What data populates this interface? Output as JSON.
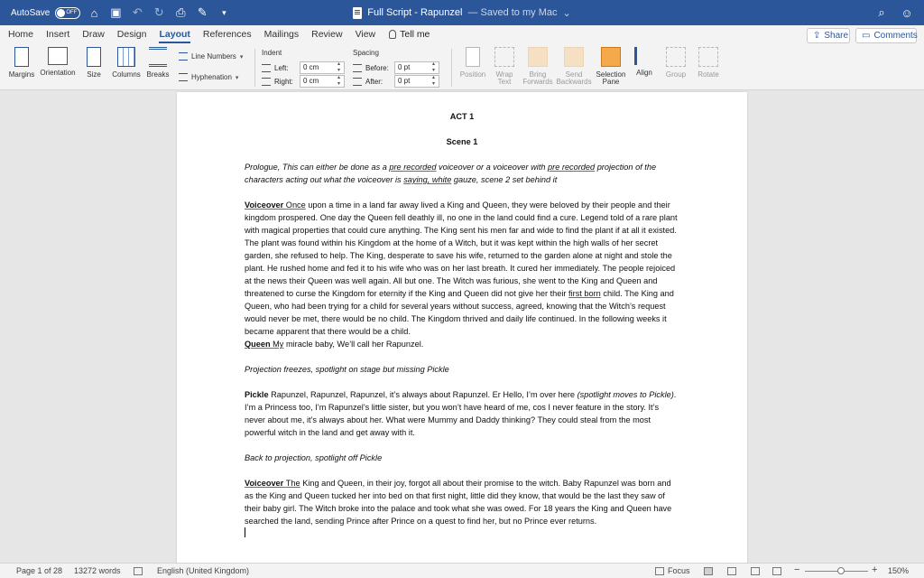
{
  "titlebar": {
    "autosave_label": "AutoSave",
    "autosave_state": "OFF",
    "doc_title": "Full Script - Rapunzel",
    "save_status": "— Saved to my Mac",
    "title_caret": "⌄"
  },
  "tabs": [
    "Home",
    "Insert",
    "Draw",
    "Design",
    "Layout",
    "References",
    "Mailings",
    "Review",
    "View"
  ],
  "tell_me": "Tell me",
  "share_label": "Share",
  "comments_label": "Comments",
  "ribbon": {
    "margins": "Margins",
    "orientation": "Orientation",
    "size": "Size",
    "columns": "Columns",
    "breaks": "Breaks",
    "line_numbers": "Line Numbers",
    "hyphenation": "Hyphenation",
    "indent_label": "Indent",
    "indent_left_label": "Left:",
    "indent_left_value": "0 cm",
    "indent_right_label": "Right:",
    "indent_right_value": "0 cm",
    "spacing_label": "Spacing",
    "spacing_before_label": "Before:",
    "spacing_before_value": "0 pt",
    "spacing_after_label": "After:",
    "spacing_after_value": "0 pt",
    "position": "Position",
    "wrap_text_1": "Wrap",
    "wrap_text_2": "Text",
    "bring_forwards_1": "Bring",
    "bring_forwards_2": "Forwards",
    "send_backwards_1": "Send",
    "send_backwards_2": "Backwards",
    "selection_pane_1": "Selection",
    "selection_pane_2": "Pane",
    "align": "Align",
    "group": "Group",
    "rotate": "Rotate"
  },
  "document": {
    "act": "ACT 1",
    "scene": "Scene 1",
    "prologue_a": "Prologue, This can either be done as a ",
    "prologue_b": "pre recorded",
    "prologue_c": " voiceover or a voiceover with ",
    "prologue_d": "pre recorded",
    "prologue_e": " projection of the characters acting out what the voiceover is ",
    "prologue_f": "saying,  white",
    "prologue_g": " gauze, scene 2 set behind it",
    "vo1_speaker": "Voiceover ",
    "vo1_first": " Once",
    "vo1_text_a": " upon a time in a land far away lived a King and Queen, they were beloved by their people and their kingdom prospered. One day the Queen fell deathly ill, no one in the land could find a cure. Legend told of a rare plant with magical properties that could cure anything. The King sent his men far and wide to find the plant if at all it existed.  The plant was found within his Kingdom at the home of a Witch, but it was kept within the high walls of her secret garden, she refused to help. The King, desperate to save his wife, returned to the garden alone at night and stole the plant. He rushed home and fed it to his wife who was on her last breath.  It cured her immediately. The people rejoiced at the news their Queen was well again. All but one.  The Witch was furious, she went to the King and Queen and threatened to curse the Kingdom for eternity if the King and Queen did not give her their ",
    "vo1_firstborn": "first born",
    "vo1_text_b": " child.  The King and Queen, who had been trying for a child for several years without success, agreed, knowing that the Witch’s request would never be met, there would be no child.  The Kingdom thrived and daily life continued. In the following weeks it became apparent that there would be a child.",
    "queen_speaker": "Queen ",
    "queen_first": " My",
    "queen_text": " miracle baby, We’ll call her Rapunzel.",
    "direction1": "Projection freezes, spotlight on stage but missing Pickle",
    "pickle_speaker": "Pickle",
    "pickle_text_a": " Rapunzel, Rapunzel, Rapunzel, it’s always about Rapunzel. Er Hello, I’m over here ",
    "pickle_direction": "(spotlight moves to Pickle)",
    "pickle_text_b": ". I’m a Princess too, I’m Rapunzel’s little sister, but you won’t have heard of me, cos I never feature in the story. It’s never about me, it’s always about her. What were Mummy and Daddy thinking? They could steal from the most powerful witch in the land and get away with it.",
    "direction2": "Back to projection, spotlight off Pickle",
    "vo2_speaker": "Voiceover ",
    "vo2_first": " The",
    "vo2_text": " King and Queen, in their joy, forgot all about their promise to the witch. Baby Rapunzel was born and as the King and Queen tucked her into bed on that first night, little did they know, that would be the last they saw of their baby girl. The Witch broke into the palace and took what she was owed. For 18 years the King and Queen have searched the land, sending Prince after Prince on a quest to find her, but no Prince ever returns."
  },
  "status": {
    "page": "Page 1 of 28",
    "words": "13272 words",
    "language": "English (United Kingdom)",
    "focus": "Focus",
    "zoom_minus": "−",
    "zoom_plus": "+",
    "zoom": "150%"
  }
}
